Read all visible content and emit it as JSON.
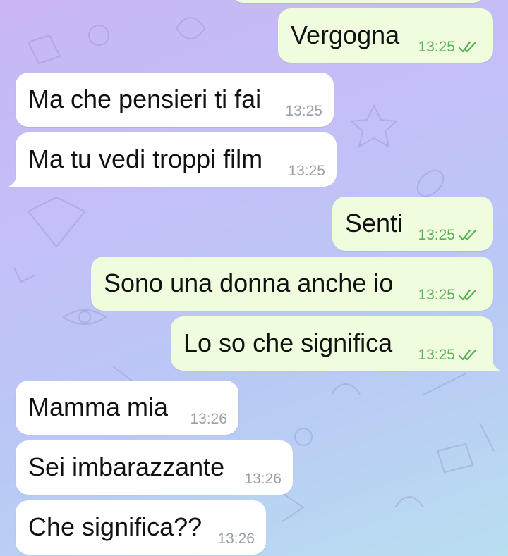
{
  "chat": {
    "messages": [
      {
        "text": "Vergogna",
        "time": "13:25",
        "direction": "out",
        "status": "read"
      },
      {
        "text": "Ma che pensieri ti fai",
        "time": "13:25",
        "direction": "in"
      },
      {
        "text": "Ma tu vedi troppi film",
        "time": "13:25",
        "direction": "in"
      },
      {
        "text": "Senti",
        "time": "13:25",
        "direction": "out",
        "status": "read"
      },
      {
        "text": "Sono una donna anche io",
        "time": "13:25",
        "direction": "out",
        "status": "read"
      },
      {
        "text": "Lo so che significa",
        "time": "13:25",
        "direction": "out",
        "status": "read"
      },
      {
        "text": "Mamma mia",
        "time": "13:26",
        "direction": "in"
      },
      {
        "text": "Sei imbarazzante",
        "time": "13:26",
        "direction": "in"
      },
      {
        "text": "Che significa??",
        "time": "13:26",
        "direction": "in"
      }
    ]
  },
  "icons": {
    "read_receipt": "double-check-icon"
  },
  "colors": {
    "incoming_bubble": "#ffffff",
    "outgoing_bubble": "#effdde",
    "read_check": "#5cae5a",
    "timestamp_incoming": "#9aa0a8"
  }
}
